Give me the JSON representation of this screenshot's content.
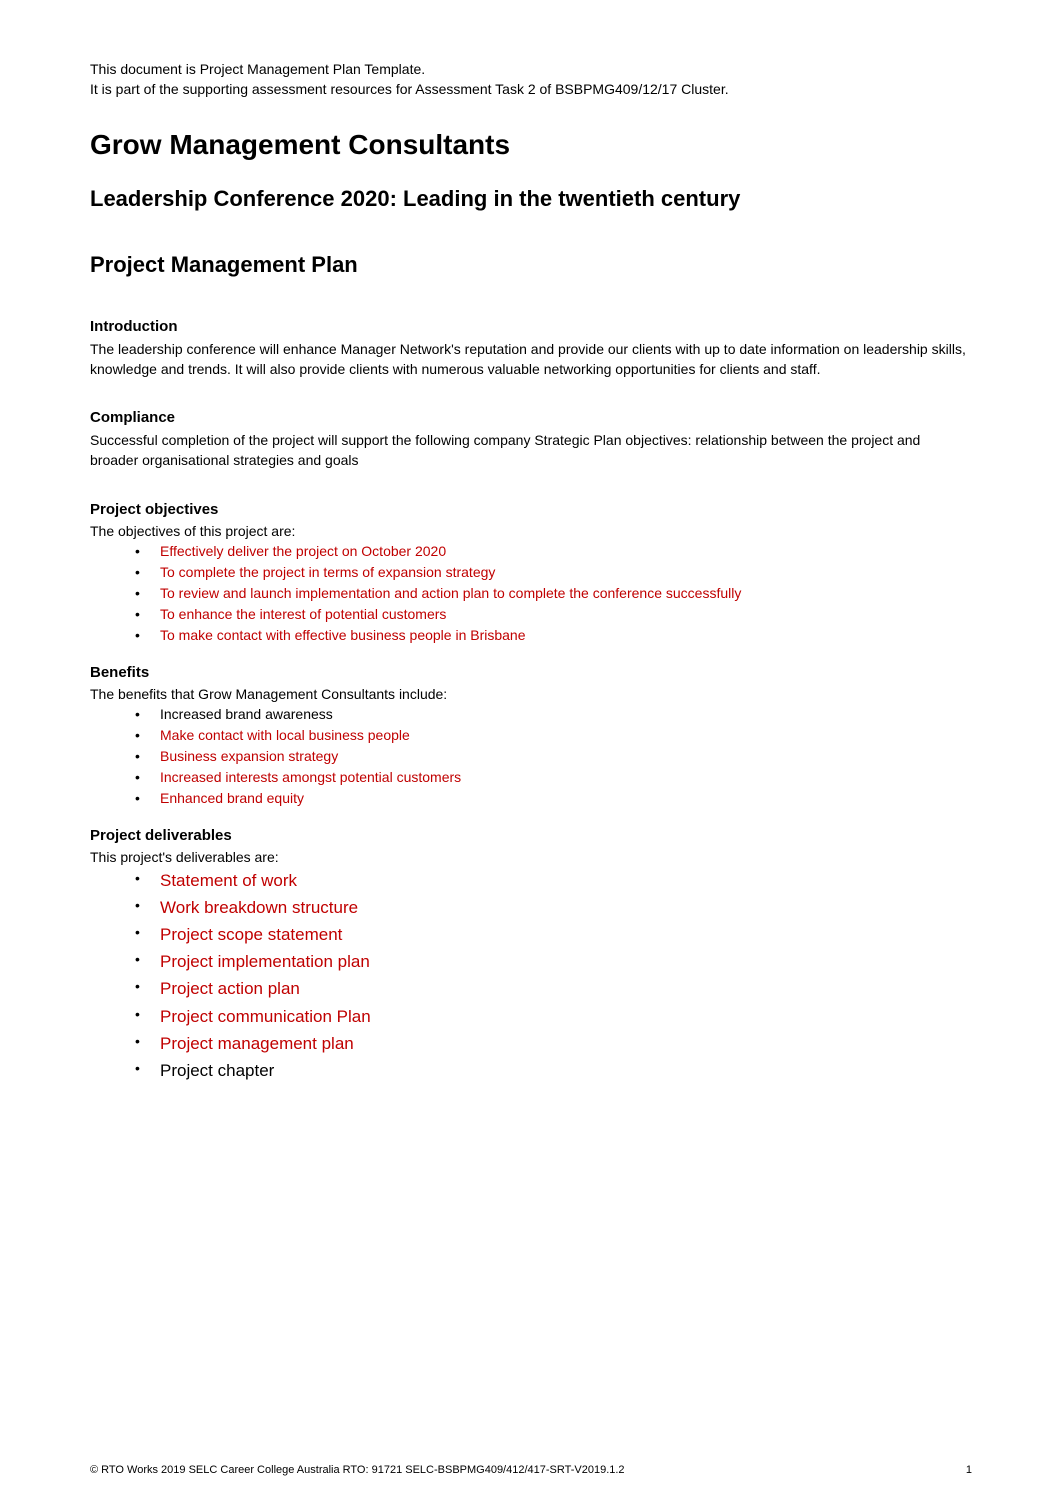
{
  "header": {
    "line1": "This document is Project Management Plan Template.",
    "line2": "It is part of the supporting assessment resources for Assessment Task 2 of BSBPMG409/12/17 Cluster."
  },
  "main_title": "Grow Management Consultants",
  "sub_title": "Leadership Conference 2020: Leading in the twentieth century",
  "section_title": "Project Management Plan",
  "introduction": {
    "heading": "Introduction",
    "body": "The leadership conference will enhance Manager Network's reputation and provide our clients with up to date information on leadership skills, knowledge and trends. It will also provide clients with numerous valuable networking opportunities for clients and staff."
  },
  "compliance": {
    "heading": "Compliance",
    "body": "Successful completion of the project will support the following company Strategic Plan objectives: relationship between the project and broader organisational strategies and goals"
  },
  "objectives": {
    "heading": "Project objectives",
    "intro": "The objectives of this project are:",
    "items": [
      {
        "text": "Effectively deliver the project on October 2020",
        "red": true
      },
      {
        "text": "To complete the project in terms of expansion strategy",
        "red": true
      },
      {
        "text": "To review and launch implementation and action plan to complete the conference successfully",
        "red": true
      },
      {
        "text": "To enhance the interest of potential customers",
        "red": true
      },
      {
        "text": "To make contact with effective business people in Brisbane",
        "red": true
      }
    ]
  },
  "benefits": {
    "heading": "Benefits",
    "intro": "The benefits that Grow Management Consultants include:",
    "items": [
      {
        "text": "Increased brand awareness",
        "red": false
      },
      {
        "text": "Make contact with local business people",
        "red": true
      },
      {
        "text": "Business expansion strategy",
        "red": true
      },
      {
        "text": "Increased interests amongst potential customers",
        "red": true
      },
      {
        "text": "Enhanced brand equity",
        "red": true
      }
    ]
  },
  "deliverables": {
    "heading": "Project deliverables",
    "intro": "This project's deliverables are:",
    "items": [
      {
        "text": "Statement of work",
        "red": true
      },
      {
        "text": "Work breakdown structure",
        "red": true
      },
      {
        "text": "Project scope statement",
        "red": true
      },
      {
        "text": "Project implementation plan",
        "red": true
      },
      {
        "text": "Project action plan",
        "red": true
      },
      {
        "text": "Project communication Plan",
        "red": true
      },
      {
        "text": "Project management plan",
        "red": true
      },
      {
        "text": "Project chapter",
        "red": false
      }
    ]
  },
  "footer": {
    "left": "© RTO Works 2019    SELC Career College Australia RTO: 91721 SELC-BSBPMG409/412/417-SRT-V2019.1.2",
    "right": "1"
  }
}
